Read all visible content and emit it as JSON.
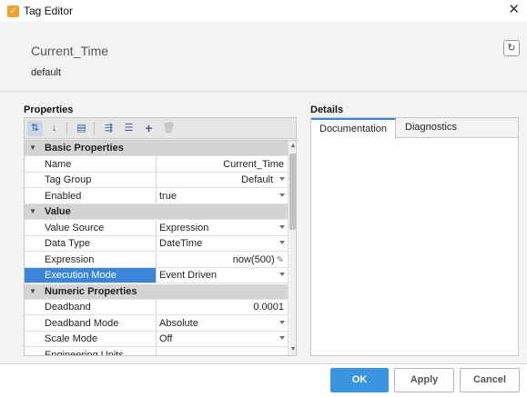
{
  "window": {
    "title": "Tag Editor",
    "icon": "checkmark-icon"
  },
  "header": {
    "tag_name": "Current_Time",
    "provider": "default",
    "refresh_icon": "refresh-icon"
  },
  "properties": {
    "title": "Properties",
    "toolbar": {
      "icons": [
        "sort-categorized-icon",
        "sort-alphabetical-icon",
        "table-view-icon",
        "expand-all-icon",
        "collapse-all-icon",
        "add-icon",
        "delete-icon"
      ]
    },
    "rows": [
      {
        "type": "category",
        "label": "Basic Properties"
      },
      {
        "type": "prop",
        "name": "Name",
        "value": "Current_Time",
        "align": "right"
      },
      {
        "type": "prop",
        "name": "Tag Group",
        "value": "Default",
        "align": "right",
        "dropdown": true
      },
      {
        "type": "prop",
        "name": "Enabled",
        "value": "true",
        "dropdown": true
      },
      {
        "type": "category",
        "label": "Value"
      },
      {
        "type": "prop",
        "name": "Value Source",
        "value": "Expression",
        "dropdown": true
      },
      {
        "type": "prop",
        "name": "Data Type",
        "value": "DateTime",
        "dropdown": true
      },
      {
        "type": "prop",
        "name": "Expression",
        "value": "now(500)",
        "align": "right",
        "edit": true
      },
      {
        "type": "prop",
        "name": "Execution Mode",
        "value": "Event Driven",
        "dropdown": true,
        "selected": true
      },
      {
        "type": "category",
        "label": "Numeric Properties"
      },
      {
        "type": "prop",
        "name": "Deadband",
        "value": "0.0001",
        "align": "right"
      },
      {
        "type": "prop",
        "name": "Deadband Mode",
        "value": "Absolute",
        "dropdown": true
      },
      {
        "type": "prop",
        "name": "Scale Mode",
        "value": "Off",
        "dropdown": true
      },
      {
        "type": "prop",
        "name": "Engineering Units",
        "value": ""
      }
    ]
  },
  "details": {
    "title": "Details",
    "tabs": [
      "Documentation",
      "Diagnostics"
    ],
    "active_tab": "Documentation"
  },
  "footer": {
    "ok": "OK",
    "apply": "Apply",
    "cancel": "Cancel"
  },
  "colors": {
    "accent": "#3a85d8",
    "ok_button": "#3a95e0",
    "app_icon": "#f3a12e",
    "category_bg": "#d4d4d4"
  }
}
